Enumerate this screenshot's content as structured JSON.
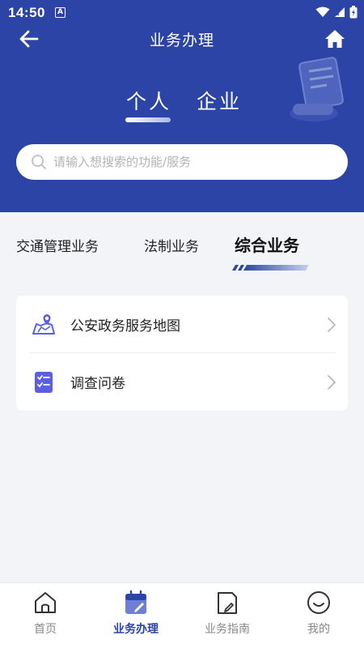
{
  "status_bar": {
    "time": "14:50",
    "notification_letter": "A"
  },
  "nav": {
    "title": "业务办理",
    "back_icon": "back-arrow-icon",
    "home_icon": "home-icon"
  },
  "segments": {
    "personal": "个人",
    "company": "企业",
    "active": "personal"
  },
  "search": {
    "placeholder": "请输入想搜索的功能/服务"
  },
  "categories": {
    "items": [
      "交通管理业务",
      "法制业务",
      "综合业务"
    ],
    "active": "综合业务"
  },
  "services": [
    {
      "label": "公安政务服务地图",
      "icon": "map-pin-icon"
    },
    {
      "label": "调查问卷",
      "icon": "checklist-icon"
    }
  ],
  "tabbar": {
    "items": [
      {
        "label": "首页",
        "icon": "home-outline-icon"
      },
      {
        "label": "业务办理",
        "icon": "business-icon"
      },
      {
        "label": "业务指南",
        "icon": "guide-icon"
      },
      {
        "label": "我的",
        "icon": "smile-icon"
      }
    ],
    "active": "业务办理"
  },
  "colors": {
    "primary": "#2b44a6",
    "background": "#f3f4f8",
    "accent_icon": "#5b5fe0"
  }
}
